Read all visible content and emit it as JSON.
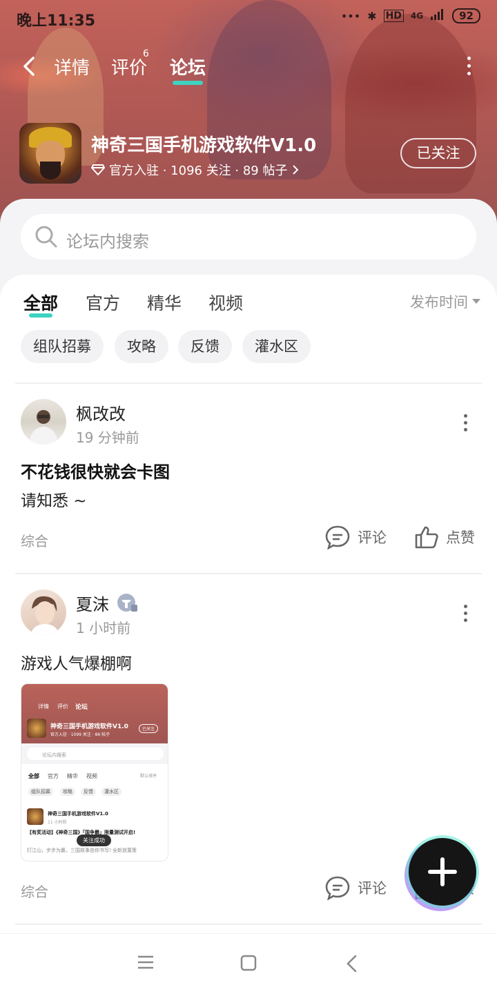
{
  "status": {
    "time": "晚上11:35",
    "battery": "92",
    "net": "4G"
  },
  "nav": {
    "tabs": [
      {
        "label": "详情"
      },
      {
        "label": "评价"
      },
      {
        "label": "论坛"
      }
    ],
    "review_badge": "6"
  },
  "app": {
    "title": "神奇三国手机游戏软件V1.0",
    "meta": "官方入驻 · 1096 关注 · 89 帖子",
    "follow_label": "已关注"
  },
  "search": {
    "placeholder": "论坛内搜索"
  },
  "filter": {
    "tabs": [
      {
        "label": "全部"
      },
      {
        "label": "官方"
      },
      {
        "label": "精华"
      },
      {
        "label": "视频"
      }
    ],
    "sort": "发布时间",
    "chips": [
      {
        "label": "组队招募"
      },
      {
        "label": "攻略"
      },
      {
        "label": "反馈"
      },
      {
        "label": "灌水区"
      }
    ]
  },
  "posts": [
    {
      "user": "枫改改",
      "time": "19 分钟前",
      "title": "不花钱很快就会卡图",
      "body": "请知悉 ~",
      "category": "综合",
      "comment_label": "评论",
      "like_label": "点赞"
    },
    {
      "user": "夏沫",
      "time": "1 小时前",
      "body": "游戏人气爆棚啊",
      "category": "综合",
      "comment_label": "评论",
      "like_label": "点赞",
      "thumbnail": {
        "tabs": [
          "详情",
          "评价",
          "论坛"
        ],
        "title": "神奇三国手机游戏软件V1.0",
        "meta": "官方入驻 · 1099 关注 · 86 帖子",
        "follow": "已关注",
        "search": "论坛内搜索",
        "filters": [
          "全部",
          "官方",
          "精华",
          "视频"
        ],
        "sort": "默认排序",
        "chips": [
          "组队招募",
          "攻略",
          "反馈",
          "灌水区"
        ],
        "post_user": "神奇三国手机游戏软件V1.0",
        "post_time": "11 小时前",
        "post_title": "【有奖活动】《神奇三国》「国争霸」限量测试开启!",
        "post_body": "打江山，步步为赢，三国故事由你书写! 全新放置策",
        "toast": "关注成功"
      }
    }
  ]
}
